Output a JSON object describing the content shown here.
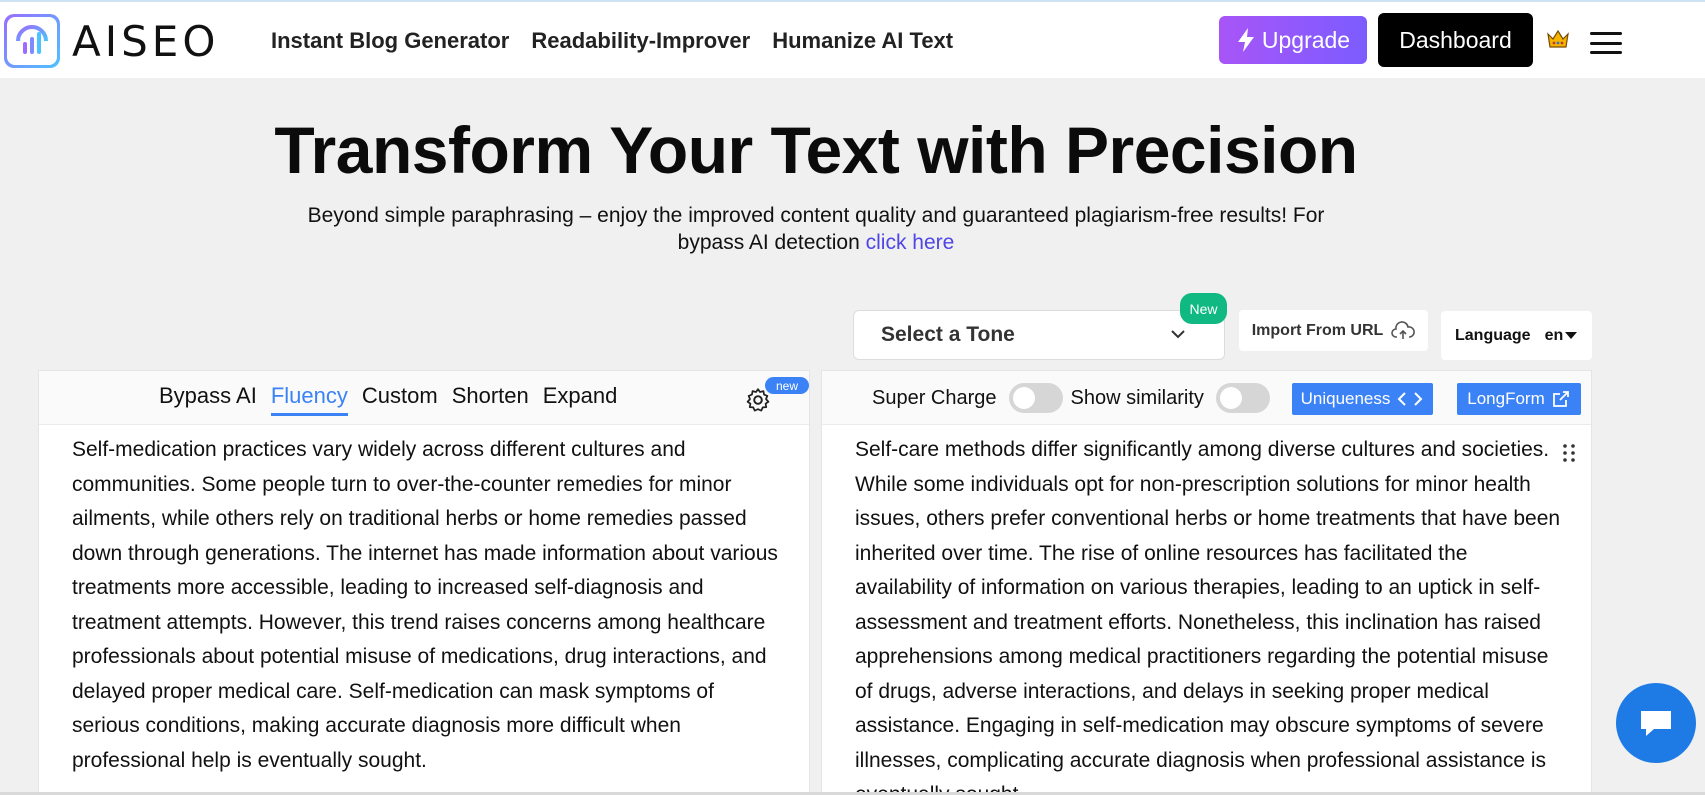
{
  "brand": {
    "name": "AISEO",
    "gradient_start": "#9a6dff",
    "gradient_end": "#4cc3ff"
  },
  "nav": {
    "links": [
      "Instant Blog Generator",
      "Readability-Improver",
      "Humanize AI Text"
    ],
    "upgrade_label": "Upgrade",
    "dashboard_label": "Dashboard"
  },
  "hero": {
    "title": "Transform Your Text with Precision",
    "subtitle": "Beyond simple paraphrasing – enjoy the improved content quality and guaranteed plagiarism-free results! For bypass AI detection",
    "link_label": "click here"
  },
  "controls": {
    "tone_placeholder": "Select a Tone",
    "tone_badge": "New",
    "import_label": "Import From URL",
    "language_label": "Language",
    "language_value": "en"
  },
  "left_panel": {
    "tabs": [
      "Bypass AI",
      "Fluency",
      "Custom",
      "Shorten",
      "Expand"
    ],
    "active_tab": "Fluency",
    "settings_badge": "new",
    "input_text": "Self-medication practices vary widely across different cultures and communities. Some people turn to over-the-counter remedies for minor ailments, while others rely on traditional herbs or home remedies passed down through generations. The internet has made information about various treatments more accessible, leading to increased self-diagnosis and treatment attempts. However, this trend raises concerns among healthcare professionals about potential misuse of medications, drug interactions, and delayed proper medical care. Self-medication can mask symptoms of serious conditions, making accurate diagnosis more difficult when professional help is eventually sought."
  },
  "right_panel": {
    "super_charge_label": "Super Charge",
    "super_charge_on": false,
    "show_similarity_label": "Show similarity",
    "show_similarity_on": false,
    "uniqueness_label": "Uniqueness",
    "longform_label": "LongForm",
    "output_text": "Self-care methods differ significantly among diverse cultures and societies. While some individuals opt for non-prescription solutions for minor health issues, others prefer conventional herbs or home treatments that have been inherited over time. The rise of online resources has facilitated the availability of information on various therapies, leading to an uptick in self-assessment and treatment efforts. Nonetheless, this inclination has raised apprehensions among medical practitioners regarding the potential misuse of drugs, adverse interactions, and delays in seeking proper medical assistance. Engaging in self-medication may obscure symptoms of severe illnesses, complicating accurate diagnosis when professional assistance is eventually sought."
  },
  "colors": {
    "accent_blue": "#3b82f6",
    "upgrade_purple": "#a855f7",
    "new_badge_green": "#10b981",
    "link_indigo": "#4f46e5",
    "chat_blue": "#1e7be6"
  },
  "icons": {
    "upgrade": "lightning-icon",
    "crown": "crown-icon",
    "menu": "hamburger-menu-icon",
    "tone_dropdown": "chevron-down-icon",
    "import": "cloud-upload-icon",
    "language_dropdown": "caret-down-icon",
    "settings": "gear-icon",
    "uniqueness": "chevron-left-right-icon",
    "longform": "external-link-icon",
    "drag": "drag-handle-icon",
    "chat": "chat-bubble-icon"
  }
}
